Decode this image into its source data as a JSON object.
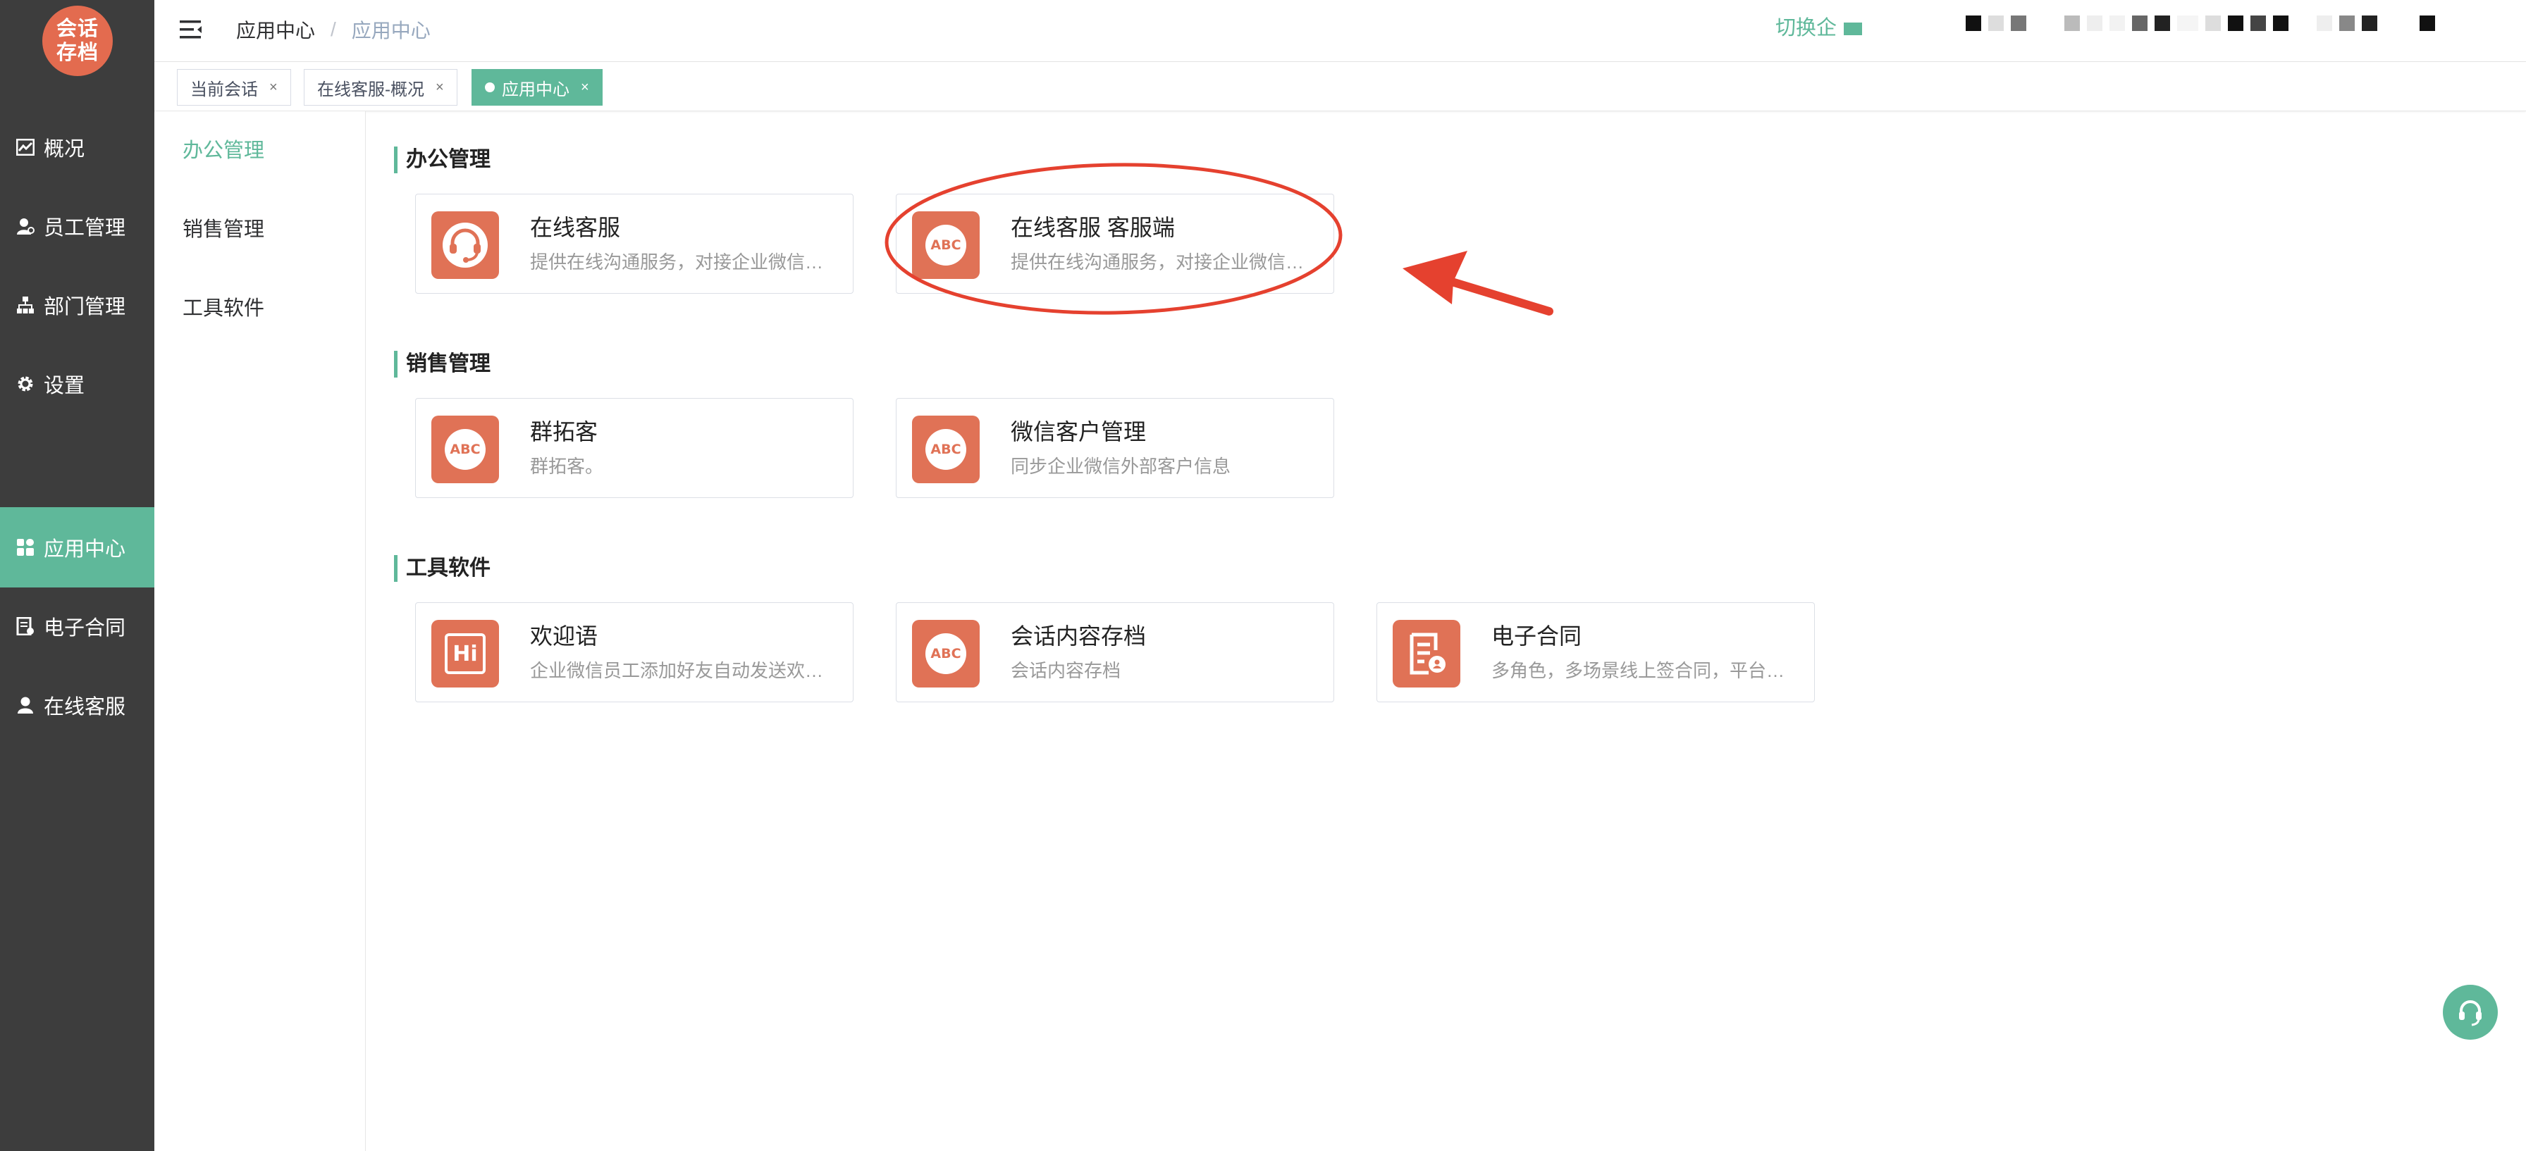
{
  "brand": {
    "logo_line1": "会话",
    "logo_line2": "存档",
    "logo_color": "#e36b4f"
  },
  "colors": {
    "accent": "#5fb89a",
    "sidebar_bg": "#3d3d3d",
    "app_icon_bg": "#e07256",
    "annotation_red": "#e5412f"
  },
  "sidebar": {
    "items": [
      {
        "label": "概况",
        "icon": "chart-icon"
      },
      {
        "label": "员工管理",
        "icon": "user-icon"
      },
      {
        "label": "部门管理",
        "icon": "org-icon"
      },
      {
        "label": "设置",
        "icon": "gear-icon"
      },
      {
        "label": "应用中心",
        "icon": "grid-icon",
        "active": true
      },
      {
        "label": "电子合同",
        "icon": "contract-icon"
      },
      {
        "label": "在线客服",
        "icon": "person-icon"
      }
    ]
  },
  "header": {
    "breadcrumb": [
      "应用中心",
      "应用中心"
    ],
    "breadcrumb_sep": "/",
    "switch_label": "切换企"
  },
  "tabs": [
    {
      "label": "当前会话",
      "close": "×"
    },
    {
      "label": "在线客服-概况",
      "close": "×"
    },
    {
      "label": "应用中心",
      "close": "×",
      "active": true
    }
  ],
  "categories": [
    {
      "label": "办公管理",
      "active": true
    },
    {
      "label": "销售管理"
    },
    {
      "label": "工具软件"
    }
  ],
  "sections": [
    {
      "title": "办公管理",
      "apps": [
        {
          "name": "在线客服",
          "desc": "提供在线沟通服务，对接企业微信…",
          "icon": "headset-icon"
        },
        {
          "name": "在线客服 客服端",
          "desc": "提供在线沟通服务，对接企业微信…",
          "icon": "abc-icon",
          "icon_text": "ABC"
        }
      ]
    },
    {
      "title": "销售管理",
      "apps": [
        {
          "name": "群拓客",
          "desc": "群拓客。",
          "icon": "abc-icon",
          "icon_text": "ABC"
        },
        {
          "name": "微信客户管理",
          "desc": "同步企业微信外部客户信息",
          "icon": "abc-icon",
          "icon_text": "ABC"
        }
      ]
    },
    {
      "title": "工具软件",
      "apps": [
        {
          "name": "欢迎语",
          "desc": "企业微信员工添加好友自动发送欢…",
          "icon": "hi-icon",
          "icon_text": "Hi"
        },
        {
          "name": "会话内容存档",
          "desc": "会话内容存档",
          "icon": "abc-icon",
          "icon_text": "ABC"
        },
        {
          "name": "电子合同",
          "desc": "多角色，多场景线上签合同，平台…",
          "icon": "contract-doc-icon"
        }
      ]
    }
  ]
}
